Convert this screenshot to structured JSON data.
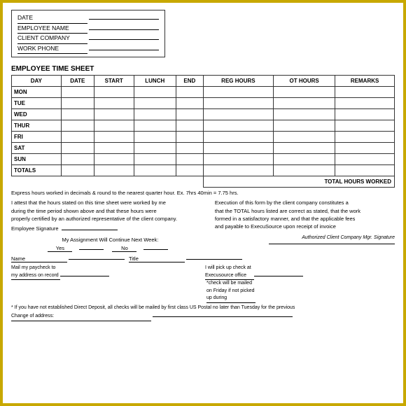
{
  "header": {
    "date_label": "DATE",
    "employee_name_label": "EMPLOYEE NAME",
    "client_company_label": "CLIENT COMPANY",
    "work_phone_label": "WORK PHONE"
  },
  "section_title": "EMPLOYEE TIME SHEET",
  "table": {
    "columns": [
      "DAY",
      "DATE",
      "START",
      "LUNCH",
      "END",
      "REG HOURS",
      "OT HOURS",
      "REMARKS"
    ],
    "rows": [
      "MON",
      "TUE",
      "WED",
      "THUR",
      "FRI",
      "SAT",
      "SUN",
      "TOTALS"
    ],
    "total_label": "TOTAL HOURS WORKED"
  },
  "express_note": "Express hours worked in decimals & round to the nearest quarter hour.  Ex.  7hrs 40min = 7.75 hrs.",
  "attest": {
    "text1": "I attest that the hours stated on this time sheet were worked by me",
    "text2": "during the time period shown above and that these hours were",
    "text3": "properly certified by an authorized representative of the client company.",
    "sig_label": "Employee Signature"
  },
  "assignment": {
    "label": "My Assignment Will Continue Next Week:",
    "yes_label": "Yes",
    "no_label": "No"
  },
  "execution": {
    "text1": "Execution of this form by the client company constitutes a",
    "text2": "that the TOTAL hours listed are correct as stated, that the work",
    "text3": "formed in a satisfactory manner, and that the applicable fees",
    "text4": "and payable to ExecuSource upon receipt of invoice",
    "sig_label": "Authorized Client Company Mgr. Signature"
  },
  "name_title": {
    "name_label": "Name",
    "title_label": "Title"
  },
  "footer": {
    "mail_label": "Mail my paycheck to my address on record",
    "pickup_label": "I will pick up check at Execusource office",
    "check_note": "*check will be mailed on Friday if not picked up during",
    "direct_deposit_note": "* If you have not established Direct Deposit, all checks will be mailed by first class US Postal no later than Tuesday for the previous",
    "change_label": "Change of address:"
  }
}
